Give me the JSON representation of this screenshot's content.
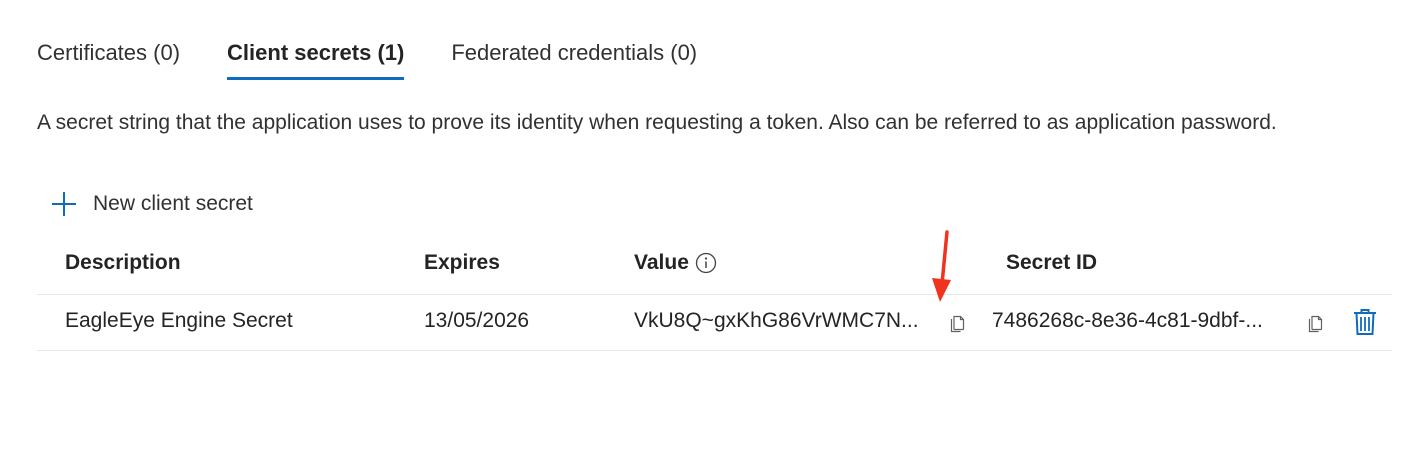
{
  "tabs": [
    {
      "label": "Certificates (0)",
      "active": false
    },
    {
      "label": "Client secrets (1)",
      "active": true
    },
    {
      "label": "Federated credentials (0)",
      "active": false
    }
  ],
  "description": "A secret string that the application uses to prove its identity when requesting a token. Also can be referred to as application password.",
  "new_button": {
    "label": "New client secret",
    "icon": "plus-icon"
  },
  "table": {
    "headers": {
      "description": "Description",
      "expires": "Expires",
      "value": "Value",
      "secret_id": "Secret ID"
    },
    "rows": [
      {
        "description": "EagleEye Engine Secret",
        "expires": "13/05/2026",
        "value": "VkU8Q~gxKhG86VrWMC7N...",
        "secret_id": "7486268c-8e36-4c81-9dbf-..."
      }
    ]
  },
  "colors": {
    "accent": "#0f6cbd",
    "annotation": "#f0321e"
  }
}
